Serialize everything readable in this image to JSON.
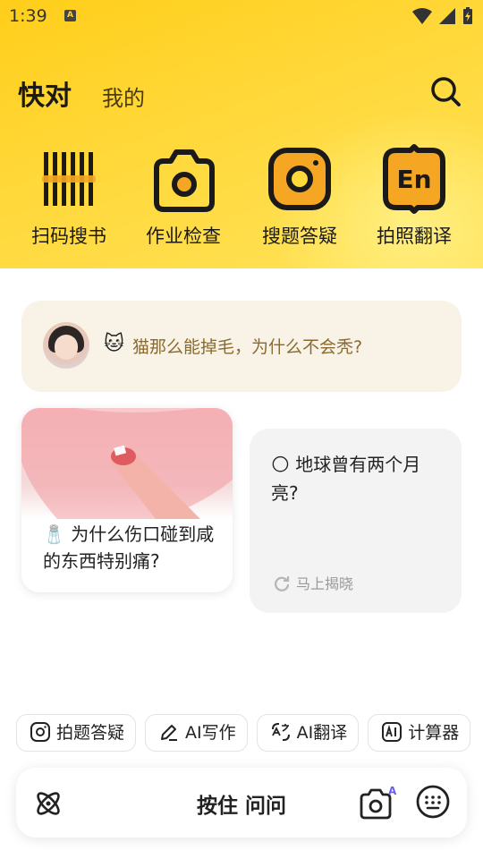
{
  "status_bar": {
    "time": "1:39",
    "notification_badge": "A"
  },
  "header": {
    "tab_active": "快对",
    "tab_mine": "我的",
    "search_icon": "search-icon"
  },
  "tools": [
    {
      "label": "扫码搜书",
      "icon": "barcode-icon"
    },
    {
      "label": "作业检查",
      "icon": "camera-icon"
    },
    {
      "label": "搜题答疑",
      "icon": "camera-square-icon"
    },
    {
      "label": "拍照翻译",
      "icon": "en-translate-icon"
    }
  ],
  "promo": {
    "emoji": "🐱",
    "text": "猫那么能掉毛，为什么不会秃?"
  },
  "cards": {
    "left": {
      "emoji": "🧂",
      "text": "为什么伤口碰到咸的东西特别痛?"
    },
    "right": {
      "emoji": "🌕",
      "text": "地球曾有两个月亮?",
      "reveal": "马上揭晓"
    }
  },
  "chips": [
    {
      "label": "拍题答疑",
      "icon": "camera-square-icon"
    },
    {
      "label": "AI写作",
      "icon": "pen-icon"
    },
    {
      "label": "AI翻译",
      "icon": "translate-icon"
    },
    {
      "label": "计算器",
      "icon": "ai-calculator-icon"
    }
  ],
  "bottom_bar": {
    "hold_label": "按住 问问",
    "ai_badge": "AI"
  },
  "colors": {
    "brand_yellow": "#ffd42a",
    "promo_text": "#8a6a2e"
  }
}
